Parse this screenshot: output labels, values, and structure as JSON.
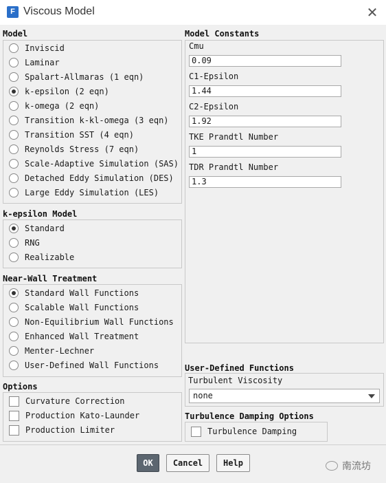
{
  "window": {
    "title": "Viscous Model",
    "app_icon": "F"
  },
  "model": {
    "title": "Model",
    "options": [
      "Inviscid",
      "Laminar",
      "Spalart-Allmaras (1 eqn)",
      "k-epsilon (2 eqn)",
      "k-omega (2 eqn)",
      "Transition k-kl-omega (3 eqn)",
      "Transition SST (4 eqn)",
      "Reynolds Stress (7 eqn)",
      "Scale-Adaptive Simulation (SAS)",
      "Detached Eddy Simulation (DES)",
      "Large Eddy Simulation (LES)"
    ],
    "selected": "k-epsilon (2 eqn)"
  },
  "kepsilon": {
    "title": "k-epsilon Model",
    "options": [
      "Standard",
      "RNG",
      "Realizable"
    ],
    "selected": "Standard"
  },
  "nearwall": {
    "title": "Near-Wall Treatment",
    "options": [
      "Standard Wall Functions",
      "Scalable Wall Functions",
      "Non-Equilibrium Wall Functions",
      "Enhanced Wall Treatment",
      "Menter-Lechner",
      "User-Defined Wall Functions"
    ],
    "selected": "Standard Wall Functions"
  },
  "options": {
    "title": "Options",
    "items": [
      "Curvature Correction",
      "Production Kato-Launder",
      "Production Limiter"
    ]
  },
  "constants": {
    "title": "Model Constants",
    "items": [
      {
        "label": "Cmu",
        "value": "0.09"
      },
      {
        "label": "C1-Epsilon",
        "value": "1.44"
      },
      {
        "label": "C2-Epsilon",
        "value": "1.92"
      },
      {
        "label": "TKE Prandtl Number",
        "value": "1"
      },
      {
        "label": "TDR Prandtl Number",
        "value": "1.3"
      }
    ]
  },
  "udf": {
    "title": "User-Defined Functions",
    "label": "Turbulent Viscosity",
    "value": "none"
  },
  "damping": {
    "title": "Turbulence Damping Options",
    "item": "Turbulence Damping"
  },
  "buttons": {
    "ok": "OK",
    "cancel": "Cancel",
    "help": "Help"
  },
  "watermark": {
    "text": "南流坊"
  },
  "colors": {
    "primary_button": "#5c6670",
    "app_icon": "#2a6fc9"
  }
}
